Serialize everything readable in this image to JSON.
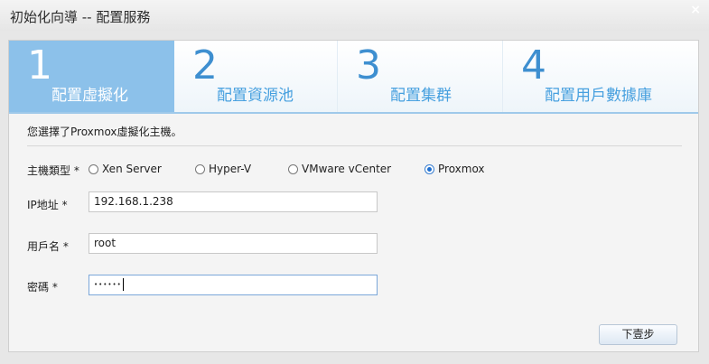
{
  "window": {
    "title": "初始化向導 -- 配置服務",
    "close_glyph": "×"
  },
  "steps": [
    {
      "number": "1",
      "label": "配置虛擬化",
      "active": true
    },
    {
      "number": "2",
      "label": "配置資源池",
      "active": false
    },
    {
      "number": "3",
      "label": "配置集群",
      "active": false
    },
    {
      "number": "4",
      "label": "配置用戶數據庫",
      "active": false
    }
  ],
  "intro_text": "您選擇了Proxmox虛擬化主機。",
  "host_type": {
    "label": "主機類型 *",
    "options": [
      "Xen Server",
      "Hyper-V",
      "VMware vCenter",
      "Proxmox"
    ],
    "selected": "Proxmox"
  },
  "ip": {
    "label": "IP地址 *",
    "value": "192.168.1.238"
  },
  "username": {
    "label": "用戶名 *",
    "value": "root"
  },
  "password": {
    "label": "密碼 *",
    "masked_value": "••••••"
  },
  "next_button": "下壹步",
  "colors": {
    "accent": "#8cc1ea",
    "step_text": "#47a0df"
  }
}
